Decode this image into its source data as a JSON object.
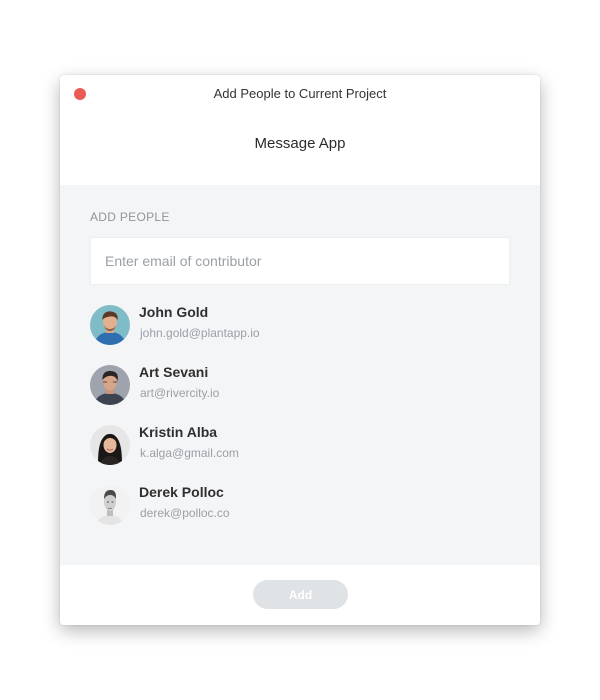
{
  "window": {
    "title": "Add People to Current Project",
    "app_name": "Message App"
  },
  "add_people": {
    "label": "ADD PEOPLE",
    "input_placeholder": "Enter email of contributor",
    "input_value": ""
  },
  "people": [
    {
      "name": "John Gold",
      "email": "john.gold@plantapp.io",
      "avatar": "avatar-john-gold"
    },
    {
      "name": "Art Sevani",
      "email": "art@rivercity.io",
      "avatar": "avatar-art-sevani"
    },
    {
      "name": "Kristin Alba",
      "email": "k.alga@gmail.com",
      "avatar": "avatar-kristin-alba"
    },
    {
      "name": "Derek Polloc",
      "email": "derek@polloc.co",
      "avatar": "avatar-derek-polloc"
    }
  ],
  "footer": {
    "add_label": "Add"
  },
  "colors": {
    "close_button": "#ec5a55",
    "panel_background": "#f4f5f7",
    "add_button_disabled": "#dfe3e6",
    "muted_text": "#9aa0a6"
  }
}
